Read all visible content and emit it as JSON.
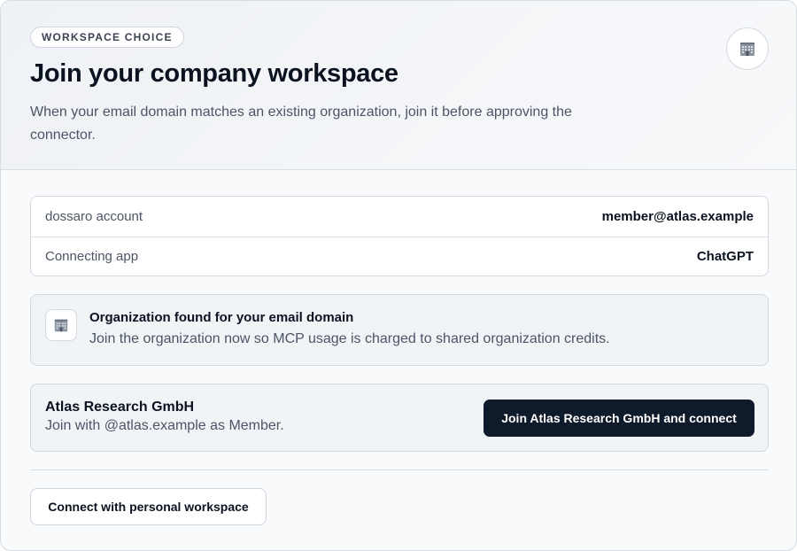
{
  "header": {
    "eyebrow": "WORKSPACE CHOICE",
    "title": "Join your company workspace",
    "subtitle": "When your email domain matches an existing organization, join it before approving the connector.",
    "icon": "office-building-icon"
  },
  "account_info": {
    "rows": [
      {
        "label": "dossaro account",
        "value": "member@atlas.example"
      },
      {
        "label": "Connecting app",
        "value": "ChatGPT"
      }
    ]
  },
  "notice": {
    "icon": "office-building-icon",
    "title": "Organization found for your email domain",
    "text": "Join the organization now so MCP usage is charged to shared organization credits."
  },
  "organization": {
    "name": "Atlas Research GmbH",
    "detail": "Join with @atlas.example as Member.",
    "join_label": "Join Atlas Research GmbH and connect"
  },
  "personal": {
    "button_label": "Connect with personal workspace"
  },
  "colors": {
    "primary_button": "#0f1a2b",
    "muted_text": "#4b5565",
    "border": "#d4d9e0"
  }
}
